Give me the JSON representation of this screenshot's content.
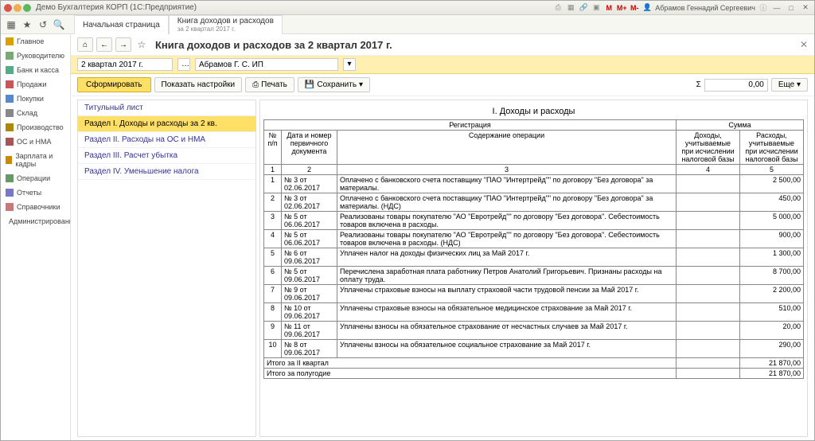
{
  "window_title": "Демо Бухгалтерия КОРП (1С:Предприятие)",
  "user": "Абрамов Геннадий Сергеевич",
  "tabs": [
    {
      "label": "Начальная страница",
      "sub": ""
    },
    {
      "label": "Книга доходов и расходов",
      "sub": "за 2 квартал 2017 г."
    }
  ],
  "sidebar": [
    {
      "label": "Главное",
      "color": "#d9a000"
    },
    {
      "label": "Руководителю",
      "color": "#7a7"
    },
    {
      "label": "Банк и касса",
      "color": "#5a8"
    },
    {
      "label": "Продажи",
      "color": "#c55"
    },
    {
      "label": "Покупки",
      "color": "#58c"
    },
    {
      "label": "Склад",
      "color": "#888"
    },
    {
      "label": "Производство",
      "color": "#a80"
    },
    {
      "label": "ОС и НМА",
      "color": "#a55"
    },
    {
      "label": "Зарплата и кадры",
      "color": "#c80"
    },
    {
      "label": "Операции",
      "color": "#696"
    },
    {
      "label": "Отчеты",
      "color": "#77c"
    },
    {
      "label": "Справочники",
      "color": "#c77"
    },
    {
      "label": "Администрирование",
      "color": "#888"
    }
  ],
  "page_title": "Книга доходов и расходов за 2 квартал 2017 г.",
  "filters": {
    "period": "2 квартал 2017 г.",
    "org": "Абрамов Г. С. ИП"
  },
  "actions": {
    "form": "Сформировать",
    "settings": "Показать настройки",
    "print": "Печать",
    "save": "Сохранить"
  },
  "sum": {
    "sigma": "Σ",
    "value": "0,00",
    "more": "Еще"
  },
  "sections": [
    "Титульный лист",
    "Раздел I. Доходы и расходы за 2 кв.",
    "Раздел II. Расходы на ОС и НМА",
    "Раздел III. Расчет убытка",
    "Раздел IV. Уменьшение налога"
  ],
  "report_title": "I. Доходы и расходы",
  "columns": {
    "reg": "Регистрация",
    "sum": "Сумма",
    "num": "№ п/п",
    "date": "Дата и номер первичного документа",
    "content": "Содержание операции",
    "income": "Доходы, учитываемые при исчислении налоговой базы",
    "expense": "Расходы, учитываемые при исчислении налоговой базы"
  },
  "index_row": [
    "1",
    "2",
    "3",
    "4",
    "5"
  ],
  "rows": [
    {
      "n": "1",
      "d": "№ 3 от 02.06.2017",
      "c": "Оплачено с банковского счета поставщику \"ПАО \"Интертрейд\"\" по договору \"Без договора\" за материалы.",
      "i": "",
      "e": "2 500,00"
    },
    {
      "n": "2",
      "d": "№ 3 от 02.06.2017",
      "c": "Оплачено с банковского счета поставщику \"ПАО \"Интертрейд\"\" по договору \"Без договора\" за материалы. (НДС)",
      "i": "",
      "e": "450,00"
    },
    {
      "n": "3",
      "d": "№ 5 от 06.06.2017",
      "c": "Реализованы товары покупателю \"АО \"Евротрейд\"\" по договору \"Без договора\". Себестоимость товаров включена в расходы.",
      "i": "",
      "e": "5 000,00"
    },
    {
      "n": "4",
      "d": "№ 5 от 06.06.2017",
      "c": "Реализованы товары покупателю \"АО \"Евротрейд\"\" по договору \"Без договора\". Себестоимость товаров включена в расходы. (НДС)",
      "i": "",
      "e": "900,00"
    },
    {
      "n": "5",
      "d": "№ 6 от 09.06.2017",
      "c": "Уплачен налог на доходы физических лиц за Май 2017 г.",
      "i": "",
      "e": "1 300,00"
    },
    {
      "n": "6",
      "d": "№ 5 от 09.06.2017",
      "c": "Перечислена заработная плата работнику Петров Анатолий Григорьевич. Признаны расходы на оплату труда.",
      "i": "",
      "e": "8 700,00"
    },
    {
      "n": "7",
      "d": "№ 9 от 09.06.2017",
      "c": "Уплачены страховые взносы на выплату страховой части трудовой пенсии за Май 2017 г.",
      "i": "",
      "e": "2 200,00"
    },
    {
      "n": "8",
      "d": "№ 10 от 09.06.2017",
      "c": "Уплачены страховые взносы на обязательное медицинское страхование за Май 2017 г.",
      "i": "",
      "e": "510,00"
    },
    {
      "n": "9",
      "d": "№ 11 от 09.06.2017",
      "c": "Уплачены взносы на обязательное страхование от несчастных случаев за Май 2017 г.",
      "i": "",
      "e": "20,00"
    },
    {
      "n": "10",
      "d": "№ 8 от 09.06.2017",
      "c": "Уплачены взносы на обязательное социальное страхование за Май 2017 г.",
      "i": "",
      "e": "290,00"
    }
  ],
  "totals": [
    {
      "label": "Итого за II квартал",
      "i": "",
      "e": "21 870,00"
    },
    {
      "label": "Итого за полугодие",
      "i": "",
      "e": "21 870,00"
    }
  ]
}
